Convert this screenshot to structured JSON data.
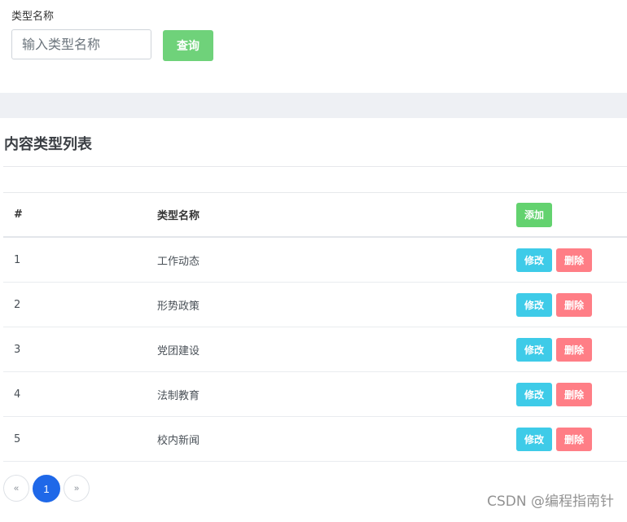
{
  "search": {
    "label": "类型名称",
    "placeholder": "输入类型名称",
    "value": "",
    "button_label": "查询"
  },
  "card": {
    "title": "内容类型列表"
  },
  "table": {
    "columns": [
      "#",
      "类型名称"
    ],
    "add_label": "添加",
    "edit_label": "修改",
    "delete_label": "删除",
    "rows": [
      {
        "index": "1",
        "name": "工作动态"
      },
      {
        "index": "2",
        "name": "形势政策"
      },
      {
        "index": "3",
        "name": "党团建设"
      },
      {
        "index": "4",
        "name": "法制教育"
      },
      {
        "index": "5",
        "name": "校内新闻"
      }
    ]
  },
  "pagination": {
    "prev": "«",
    "current": "1",
    "next": "»"
  },
  "watermark": "CSDN @编程指南针",
  "colors": {
    "search_button": "#6fd27a",
    "add_button": "#63d26f",
    "edit_button": "#3ecbe8",
    "delete_button": "#ff7e86",
    "active_page": "#1f68e8"
  }
}
